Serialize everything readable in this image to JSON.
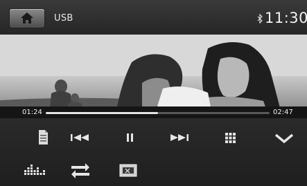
{
  "header": {
    "source_label": "USB",
    "bluetooth_icon": "bluetooth-icon",
    "clock": "11:30",
    "home_icon": "home-icon"
  },
  "player": {
    "elapsed": "01:24",
    "duration": "02:47",
    "progress_fraction": 0.5
  },
  "controls": {
    "row1": [
      "file-list-icon",
      "previous-track-icon",
      "pause-icon",
      "next-track-icon",
      "grid-menu-icon",
      "chevron-down-icon"
    ],
    "row2": [
      "equalizer-icon",
      "repeat-icon",
      "picture-mode-icon"
    ]
  },
  "colors": {
    "bar_background": "#262626",
    "text": "#f0f0f0",
    "progress_fill": "#e4e4e4"
  }
}
